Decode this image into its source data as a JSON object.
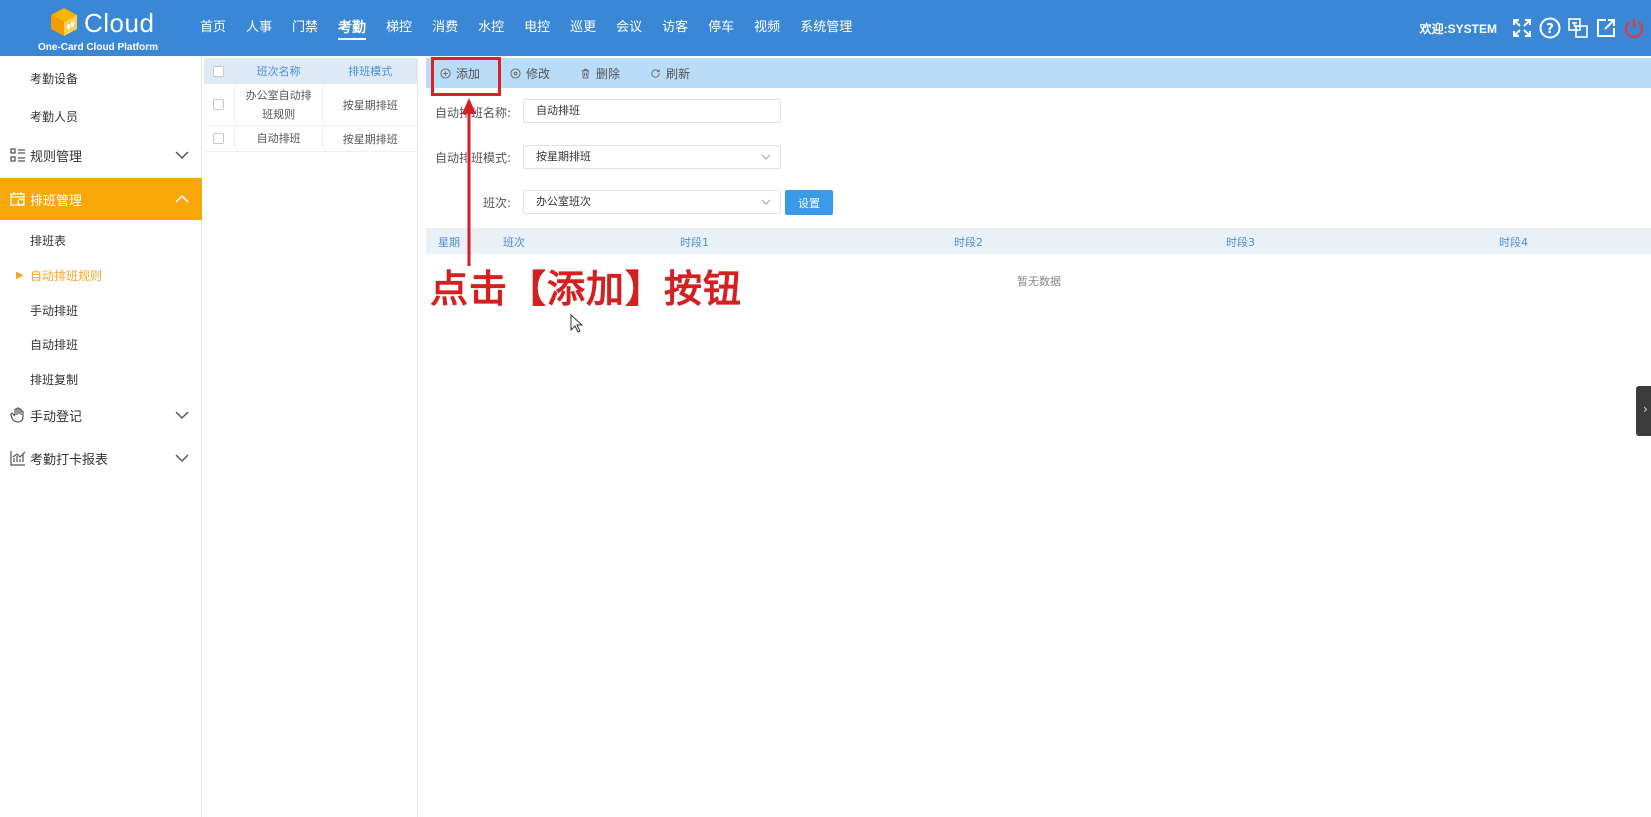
{
  "header": {
    "logo_text": "Cloud",
    "logo_subtitle": "One-Card Cloud Platform",
    "nav": [
      "首页",
      "人事",
      "门禁",
      "考勤",
      "梯控",
      "消费",
      "水控",
      "电控",
      "巡更",
      "会议",
      "访客",
      "停车",
      "视频",
      "系统管理"
    ],
    "nav_active": "考勤",
    "welcome": "欢迎:SYSTEM",
    "icons": [
      "fullscreen-icon",
      "help-icon",
      "language-icon",
      "external-link-icon",
      "power-icon"
    ]
  },
  "sidebar": {
    "item_devices": "考勤设备",
    "item_personnel": "考勤人员",
    "group_rules": "规则管理",
    "group_schedule": "排班管理",
    "sub_table": "排班表",
    "sub_auto_rule": "自动排班规则",
    "sub_manual": "手动排班",
    "sub_auto": "自动排班",
    "sub_copy": "排班复制",
    "group_manual_register": "手动登记",
    "group_report": "考勤打卡报表"
  },
  "list": {
    "col_name": "班次名称",
    "col_mode": "排班模式",
    "rows": [
      {
        "name": "办公室自动排班规则",
        "mode": "按星期排班"
      },
      {
        "name": "自动排班",
        "mode": "按星期排班"
      }
    ]
  },
  "toolbar": {
    "add": "添加",
    "edit": "修改",
    "delete": "删除",
    "refresh": "刷新"
  },
  "form": {
    "name_label": "自动排班名称:",
    "name_value": "自动排班",
    "mode_label": "自动排班模式:",
    "mode_value": "按星期排班",
    "shift_label": "班次:",
    "shift_value": "办公室班次",
    "set_button": "设置"
  },
  "table": {
    "columns": [
      "星期",
      "班次",
      "时段1",
      "时段2",
      "时段3",
      "时段4"
    ],
    "empty": "暂无数据"
  },
  "annotation": {
    "text": "点击【添加】按钮"
  },
  "colors": {
    "header_bg": "#3a87d6",
    "accent_orange": "#f7a70a",
    "toolbar_bg": "#b9dcf8",
    "annotation_red": "#d42020",
    "button_blue": "#3b9ae8"
  }
}
